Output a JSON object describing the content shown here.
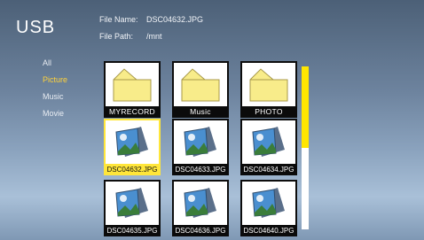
{
  "header": {
    "title": "USB",
    "file_name_label": "File Name:",
    "file_name_value": "DSC04632.JPG",
    "file_path_label": "File Path:",
    "file_path_value": "/mnt"
  },
  "menu": {
    "items": [
      {
        "label": "All",
        "active": false
      },
      {
        "label": "Picture",
        "active": true
      },
      {
        "label": "Music",
        "active": false
      },
      {
        "label": "Movie",
        "active": false
      }
    ]
  },
  "grid": {
    "items": [
      {
        "label": "MYRECORD",
        "type": "folder",
        "icon": "folder-icon"
      },
      {
        "label": "Music",
        "type": "folder",
        "icon": "folder-icon"
      },
      {
        "label": "PHOTO",
        "type": "folder",
        "icon": "folder-icon"
      },
      {
        "label": "DSC04632.JPG",
        "type": "image",
        "icon": "image-file-icon",
        "selected": true
      },
      {
        "label": "DSC04633.JPG",
        "type": "image",
        "icon": "image-file-icon"
      },
      {
        "label": "DSC04634.JPG",
        "type": "image",
        "icon": "image-file-icon"
      },
      {
        "label": "DSC04635.JPG",
        "type": "image",
        "icon": "image-file-icon"
      },
      {
        "label": "DSC04636.JPG",
        "type": "image",
        "icon": "image-file-icon"
      },
      {
        "label": "DSC04640.JPG",
        "type": "image",
        "icon": "image-file-icon"
      }
    ]
  },
  "scrollbar": {
    "position_fraction": 0.5
  },
  "colors": {
    "highlight": "#ffe63a",
    "active_menu": "#ffd23a",
    "folder": "#f8ec8a"
  }
}
